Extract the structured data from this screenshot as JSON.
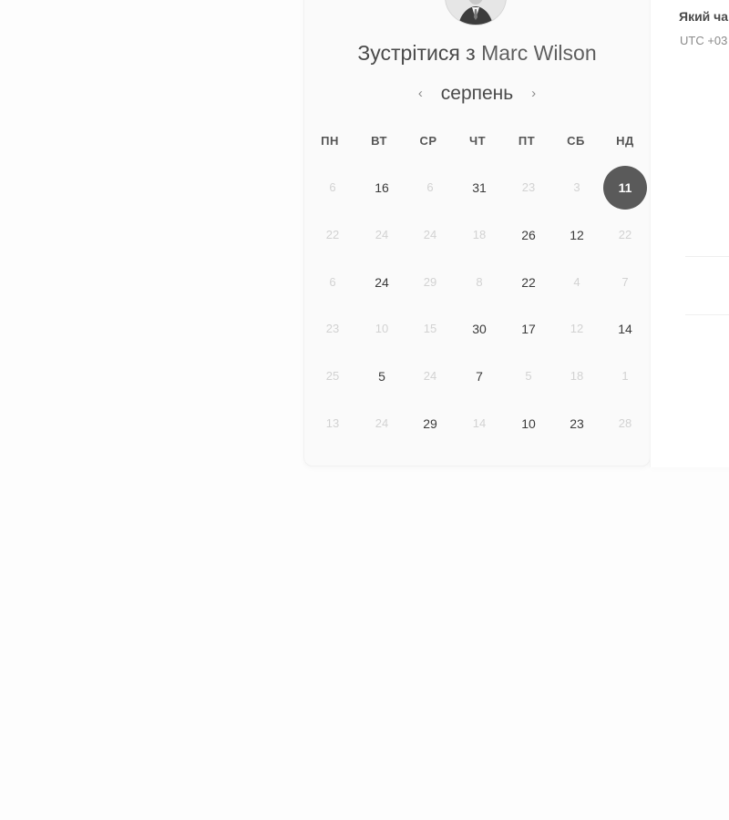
{
  "header": {
    "title_prefix": "Зустрітися з",
    "host_name": "Marc Wilson"
  },
  "calendar": {
    "month": "серпень",
    "prev_icon": "chevron-left-icon",
    "next_icon": "chevron-right-icon",
    "weekdays": [
      "ПН",
      "ВТ",
      "СР",
      "ЧТ",
      "ПТ",
      "СБ",
      "НД"
    ],
    "weeks": [
      [
        {
          "d": "6",
          "a": false
        },
        {
          "d": "16",
          "a": true
        },
        {
          "d": "6",
          "a": false
        },
        {
          "d": "31",
          "a": true
        },
        {
          "d": "23",
          "a": false
        },
        {
          "d": "3",
          "a": false
        },
        {
          "d": "11",
          "a": true,
          "s": true
        }
      ],
      [
        {
          "d": "22",
          "a": false
        },
        {
          "d": "24",
          "a": false
        },
        {
          "d": "24",
          "a": false
        },
        {
          "d": "18",
          "a": false
        },
        {
          "d": "26",
          "a": true
        },
        {
          "d": "12",
          "a": true
        },
        {
          "d": "22",
          "a": false
        }
      ],
      [
        {
          "d": "6",
          "a": false
        },
        {
          "d": "24",
          "a": true
        },
        {
          "d": "29",
          "a": false
        },
        {
          "d": "8",
          "a": false
        },
        {
          "d": "22",
          "a": true
        },
        {
          "d": "4",
          "a": false
        },
        {
          "d": "7",
          "a": false
        }
      ],
      [
        {
          "d": "23",
          "a": false
        },
        {
          "d": "10",
          "a": false
        },
        {
          "d": "15",
          "a": false
        },
        {
          "d": "30",
          "a": true
        },
        {
          "d": "17",
          "a": true
        },
        {
          "d": "12",
          "a": false
        },
        {
          "d": "14",
          "a": true
        }
      ],
      [
        {
          "d": "25",
          "a": false
        },
        {
          "d": "5",
          "a": true
        },
        {
          "d": "24",
          "a": false
        },
        {
          "d": "7",
          "a": true
        },
        {
          "d": "5",
          "a": false
        },
        {
          "d": "18",
          "a": false
        },
        {
          "d": "1",
          "a": false
        }
      ],
      [
        {
          "d": "13",
          "a": false
        },
        {
          "d": "24",
          "a": false
        },
        {
          "d": "29",
          "a": true
        },
        {
          "d": "14",
          "a": false
        },
        {
          "d": "10",
          "a": true
        },
        {
          "d": "23",
          "a": true
        },
        {
          "d": "28",
          "a": false
        }
      ]
    ]
  },
  "right_panel": {
    "title": "Який ча",
    "timezone": "UTC +03"
  },
  "colors": {
    "selected_bg": "#5a5a5a",
    "available_text": "#3a3a3a",
    "unavailable_text": "#d2d2d2"
  }
}
